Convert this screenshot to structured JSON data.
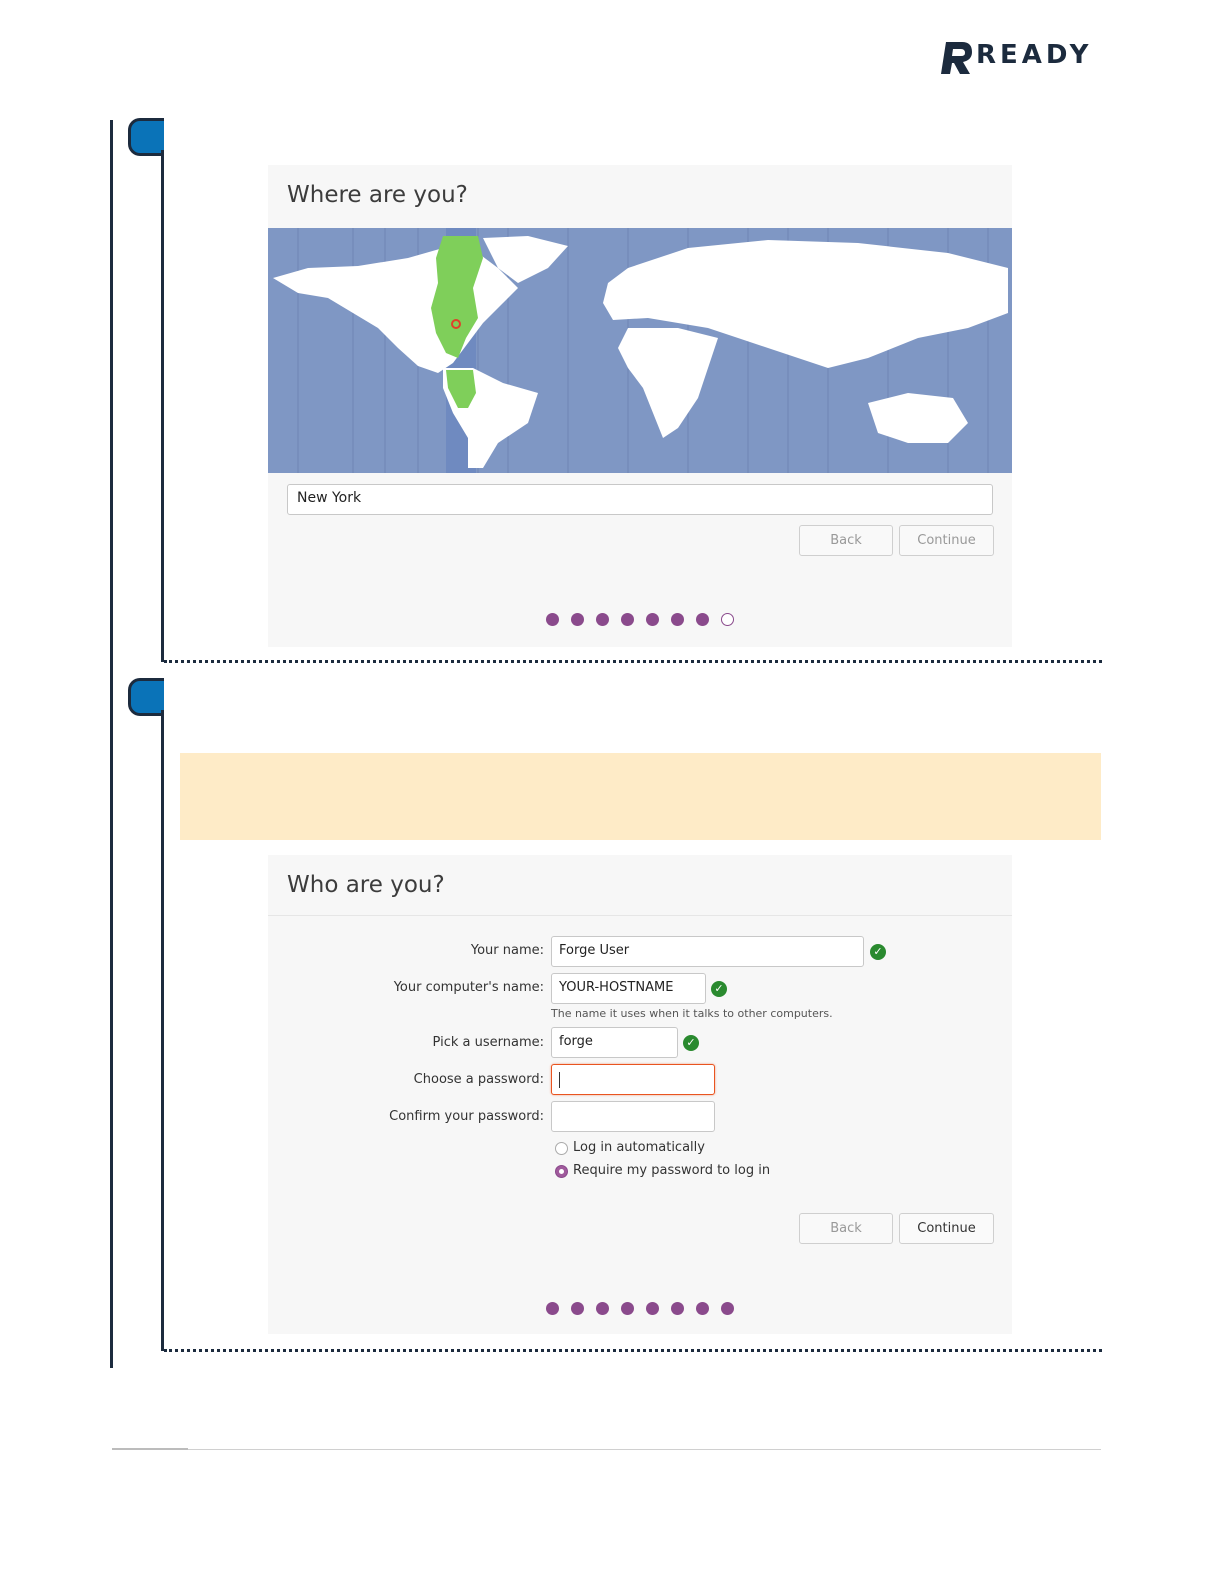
{
  "logo": {
    "text": "READY"
  },
  "location_panel": {
    "title": "Where are you?",
    "timezone_value": "New York",
    "back_label": "Back",
    "continue_label": "Continue",
    "progress": {
      "total": 8,
      "filled": 7
    }
  },
  "user_panel": {
    "title": "Who are you?",
    "fields": {
      "your_name": {
        "label": "Your name:",
        "value": "Forge User"
      },
      "computer_name": {
        "label": "Your computer's name:",
        "value": "YOUR-HOSTNAME",
        "hint": "The name it uses when it talks to other computers."
      },
      "username": {
        "label": "Pick a username:",
        "value": "forge"
      },
      "password": {
        "label": "Choose a password:",
        "value": ""
      },
      "confirm_password": {
        "label": "Confirm your password:",
        "value": ""
      }
    },
    "login_options": {
      "auto": "Log in automatically",
      "require_password": "Require my password to log in",
      "selected": "require_password"
    },
    "back_label": "Back",
    "continue_label": "Continue",
    "progress": {
      "total": 8,
      "filled": 8
    }
  },
  "colors": {
    "brand_dark": "#1c2b3e",
    "step_blue": "#0a73b8",
    "progress_purple": "#8a4a8c",
    "map_ocean": "#7f97c4",
    "map_highlight": "#7fcf5a",
    "note_background": "#feebc7",
    "valid_green": "#2a8a2f",
    "focus_orange": "#e95420"
  }
}
